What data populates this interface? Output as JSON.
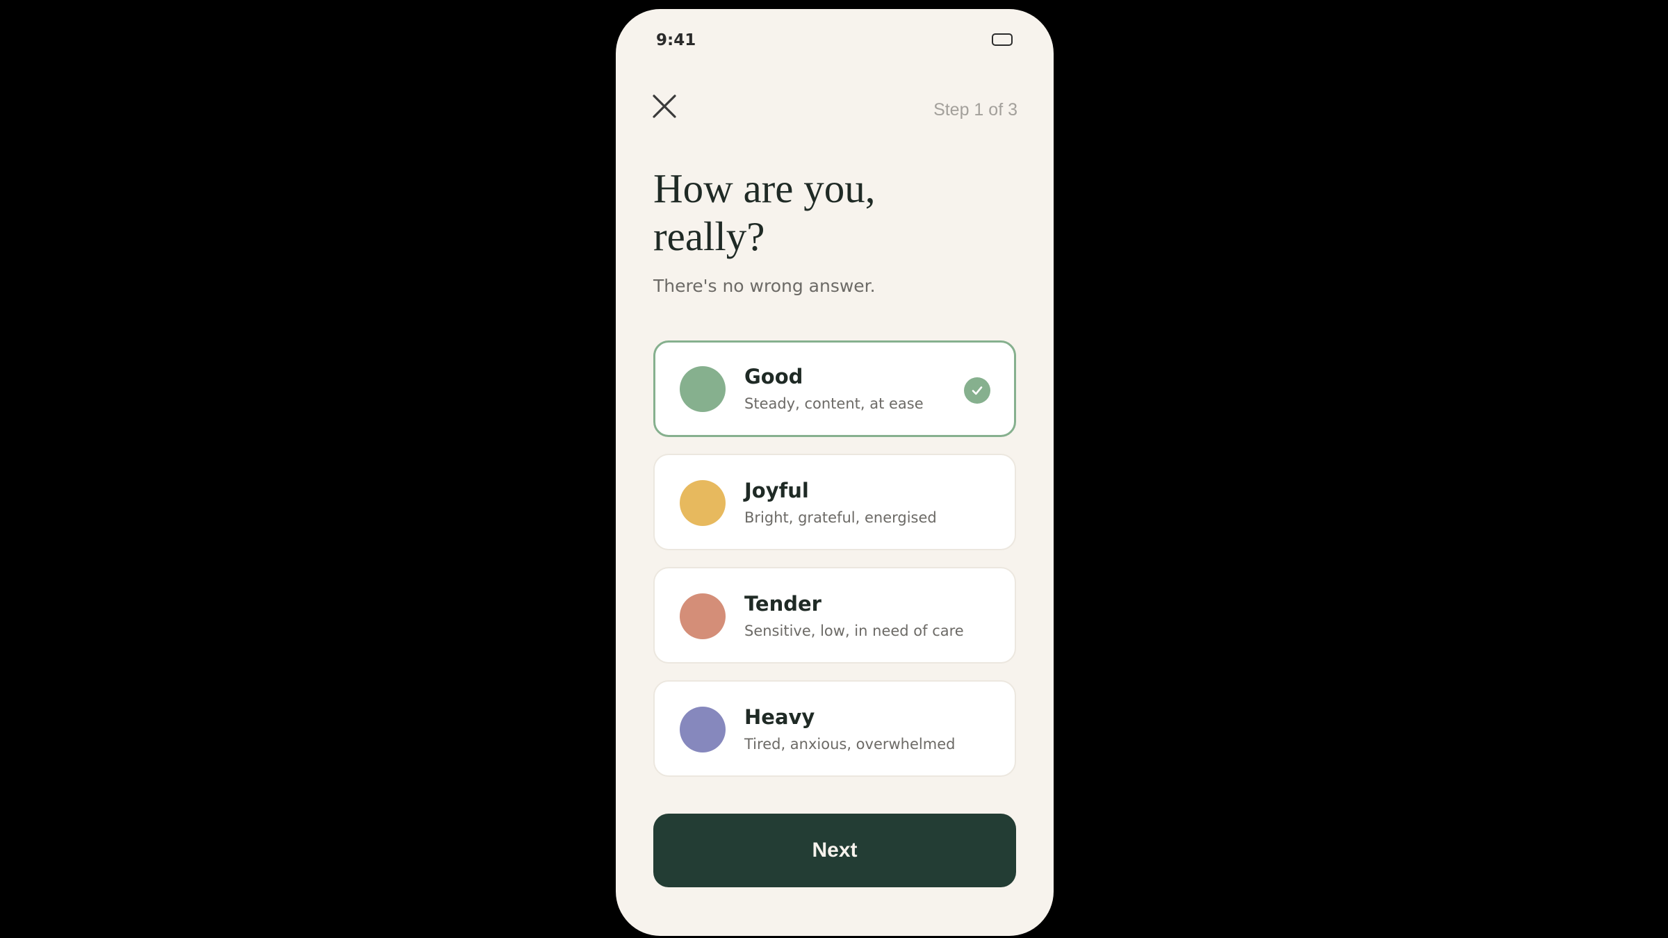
{
  "status_bar": {
    "time": "9:41",
    "battery_icon": "battery-icon"
  },
  "header": {
    "close_icon": "close-icon",
    "step": "Step 1 of 3"
  },
  "title": "How are you,\nreally?",
  "subtitle": "There's no wrong answer.",
  "options": [
    {
      "label": "Good",
      "description": "Steady, content, at ease",
      "color": "#86b08e",
      "selected": true
    },
    {
      "label": "Joyful",
      "description": "Bright, grateful, energised",
      "color": "#e7b95e",
      "selected": false
    },
    {
      "label": "Tender",
      "description": "Sensitive, low, in need of care",
      "color": "#d48e78",
      "selected": false
    },
    {
      "label": "Heavy",
      "description": "Tired, anxious, overwhelmed",
      "color": "#8688bd",
      "selected": false
    }
  ],
  "next_button": {
    "label": "Next"
  },
  "colors": {
    "background": "#000000",
    "screen": "#f7f3ed",
    "primary": "#233d34",
    "accent": "#86b08e"
  }
}
